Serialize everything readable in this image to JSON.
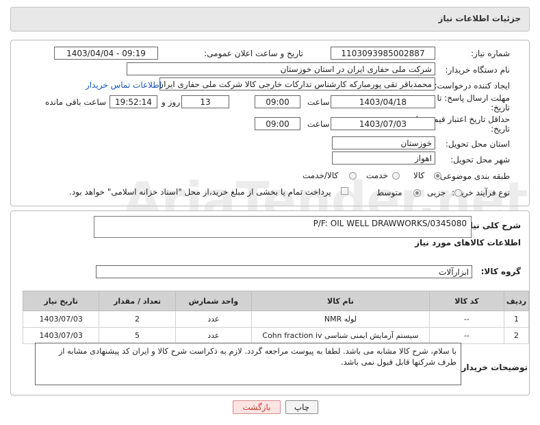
{
  "header": {
    "title": "جزئیات اطلاعات نیاز"
  },
  "form": {
    "need_number_label": "شماره نیاز:",
    "need_number": "1103093985002887",
    "announce_label": "تاریخ و ساعت اعلان عمومی:",
    "announce_value": "1403/04/04 - 09:19",
    "buyer_org_label": "نام دستگاه خریدار:",
    "buyer_org": "شرکت ملی حفاری ایران در استان خوزستان",
    "requester_label": "ایجاد کننده درخواست:",
    "requester": "محمدباقر تقی پورمبارکه کارشناس تدارکات خارجی کالا شرکت ملی حفاری ایران",
    "contact_link": "اطلاعات تماس خریدار",
    "deadline_label_1": "مهلت ارسال پاسخ: تا",
    "deadline_label_2": "تاریخ:",
    "deadline_date": "1403/04/18",
    "time_label": "ساعت",
    "deadline_time": "09:00",
    "days_value": "13",
    "days_label": "روز و",
    "remaining_time": "19:52:14",
    "remaining_label": "ساعت باقی مانده",
    "validity_label_1": "حداقل تاریخ اعتبار قیمت: تا",
    "validity_label_2": "تاریخ:",
    "validity_date": "1403/07/03",
    "validity_time": "09:00",
    "province_label": "استان محل تحویل:",
    "province": "خوزستان",
    "city_label": "شهر محل تحویل:",
    "city": "اهواز",
    "category_label": "طبقه بندی موضوعی:",
    "category_options": [
      "کالا",
      "خدمت",
      "کالا/خدمت"
    ],
    "process_label": "نوع فرآیند خرید :",
    "process_options": [
      "جزیی",
      "متوسط"
    ],
    "payment_note": "پرداخت تمام یا بخشی از مبلغ خرید،از محل \"اسناد خزانه اسلامی\" خواهد بود."
  },
  "details": {
    "summary_label": "شرح کلی نیاز:",
    "summary": "P/F: OIL WELL DRAWWORKS/0345080",
    "goods_info_title": "اطلاعات کالاهای مورد نیاز",
    "group_label": "گروه کالا:",
    "group": "ابزارآلات"
  },
  "table": {
    "columns": [
      "ردیف",
      "کد کالا",
      "نام کالا",
      "واحد شمارش",
      "تعداد / مقدار",
      "تاریخ نیاز"
    ],
    "rows": [
      [
        "1",
        "--",
        "لوله NMR",
        "عدد",
        "2",
        "1403/07/03"
      ],
      [
        "2",
        "--",
        "سیستم آزمایش ایمنی شناسی Cohn fraction iv",
        "عدد",
        "5",
        "1403/07/03"
      ]
    ]
  },
  "buyer_notes": {
    "label": "توضیحات خریدار:",
    "text": "با سلام، شرح کالا مشابه می باشد. لطفا به پیوست مراجعه گردد. لازم به ذکراست شرح کالا و ایران کد  پیشنهادی مشابه از طرف شرکتها قابل قبول نمی باشد."
  },
  "buttons": {
    "print": "چاپ",
    "back": "بازگشت"
  },
  "watermark": "AriaTender.net",
  "colors": {
    "link": "#1a55b8",
    "back_button_bg": "#fde4e4",
    "back_button_text": "#c0392b",
    "table_header_bg": "#d2d2d2"
  }
}
